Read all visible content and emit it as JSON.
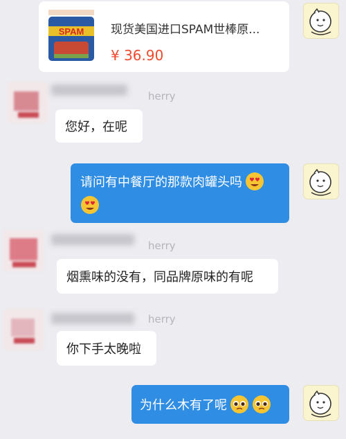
{
  "product": {
    "title": "现货美国进口SPAM世棒原...",
    "price": "¥ 36.90",
    "can_brand": "SPAM"
  },
  "sender": {
    "name_suffix": "herry"
  },
  "messages": [
    {
      "from": "seller",
      "text": "您好，在呢"
    },
    {
      "from": "buyer",
      "text": "请问有中餐厅的那款肉罐头吗",
      "emoji": [
        "heart-eyes-emoji",
        "heart-eyes-emoji"
      ]
    },
    {
      "from": "seller",
      "text": "烟熏味的没有，同品牌原味的有呢"
    },
    {
      "from": "seller",
      "text": "你下手太晚啦"
    },
    {
      "from": "buyer",
      "text": "为什么木有了呢",
      "emoji": [
        "pleading-face-emoji",
        "pleading-face-emoji"
      ]
    }
  ],
  "colors": {
    "background": "#ececf1",
    "buyer_bubble": "#2f8de4",
    "price": "#f04a2e"
  }
}
